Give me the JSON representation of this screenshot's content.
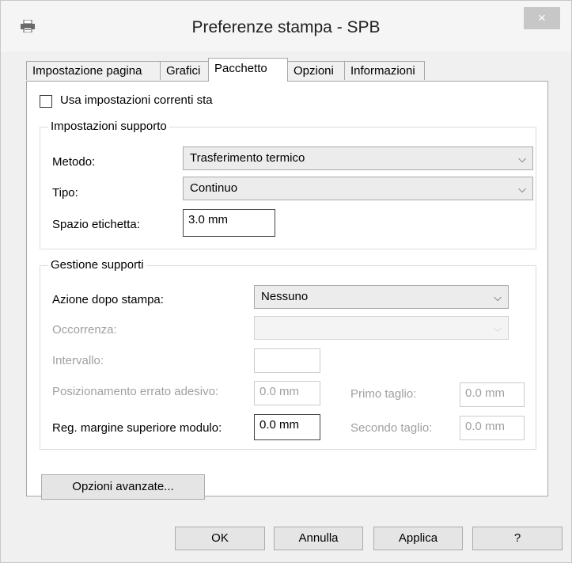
{
  "window": {
    "title": "Preferenze stampa - SPB",
    "close": "×"
  },
  "tabs": [
    "Impostazione pagina",
    "Grafici",
    "Pacchetto",
    "Opzioni",
    "Informazioni"
  ],
  "use_current": {
    "label": "Usa impostazioni correnti sta",
    "checked": false
  },
  "media_settings": {
    "title": "Impostazioni supporto",
    "method_label": "Metodo:",
    "method_value": "Trasferimento termico",
    "type_label": "Tipo:",
    "type_value": "Continuo",
    "gap_label": "Spazio etichetta:",
    "gap_value": "3.0 mm"
  },
  "media_handling": {
    "title": "Gestione supporti",
    "action_label": "Azione dopo stampa:",
    "action_value": "Nessuno",
    "occurrence_label": "Occorrenza:",
    "occurrence_value": "",
    "interval_label": "Intervallo:",
    "interval_value": "",
    "misplace_label": "Posizionamento errato adesivo:",
    "misplace_value": "0.0 mm",
    "first_cut_label": "Primo taglio:",
    "first_cut_value": "0.0 mm",
    "top_margin_label": "Reg. margine superiore modulo:",
    "top_margin_value": "0.0 mm",
    "second_cut_label": "Secondo taglio:",
    "second_cut_value": "0.0 mm"
  },
  "advanced_button": "Opzioni avanzate...",
  "footer": {
    "ok": "OK",
    "cancel": "Annulla",
    "apply": "Applica",
    "help": "?"
  }
}
